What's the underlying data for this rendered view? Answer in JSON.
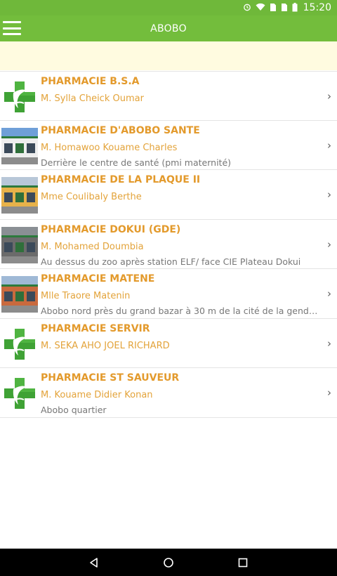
{
  "status_bar": {
    "time": "15:20",
    "icons": [
      "alarm-icon",
      "wifi-icon",
      "sim1-icon",
      "sim2-icon",
      "battery-icon"
    ]
  },
  "app_bar": {
    "title": "ABOBO",
    "menu_icon": "hamburger-menu-icon"
  },
  "pharmacies": [
    {
      "name": "PHARMACIE B.S.A",
      "owner": "M. Sylla Cheick Oumar",
      "address": "",
      "thumb": "green-cross-logo"
    },
    {
      "name": "PHARMACIE D'ABOBO SANTE",
      "owner": "M. Homawoo Kouame Charles",
      "address": "Derrière le centre de santé (pmi  maternité)",
      "thumb": "storefront-photo"
    },
    {
      "name": "PHARMACIE DE LA PLAQUE II",
      "owner": "Mme Coulibaly Berthe",
      "address": "",
      "thumb": "storefront-photo"
    },
    {
      "name": "PHARMACIE DOKUI (GDE)",
      "owner": "M. Mohamed Doumbia",
      "address": "Au dessus du zoo après station ELF/ face CIE Plateau Dokui",
      "thumb": "storefront-photo"
    },
    {
      "name": "PHARMACIE MATENE",
      "owner": "Mlle Traore Matenin",
      "address": "Abobo nord près du grand bazar à 30 m de la cité de la gendar...",
      "thumb": "storefront-photo"
    },
    {
      "name": "PHARMACIE SERVIR",
      "owner": "M. SEKA AHO JOEL RICHARD",
      "address": "",
      "thumb": "green-cross-logo"
    },
    {
      "name": "PHARMACIE ST SAUVEUR",
      "owner": "M. Kouame Didier Konan",
      "address": "Abobo quartier",
      "thumb": "green-cross-logo"
    }
  ],
  "chevron": "›",
  "nav_bar": {
    "icons": [
      "back-icon",
      "home-icon",
      "recents-icon"
    ]
  },
  "colors": {
    "accent": "#73bd3c",
    "title": "#e39a2c",
    "subtitle": "#e3a33a",
    "notice": "#fffbe0"
  }
}
